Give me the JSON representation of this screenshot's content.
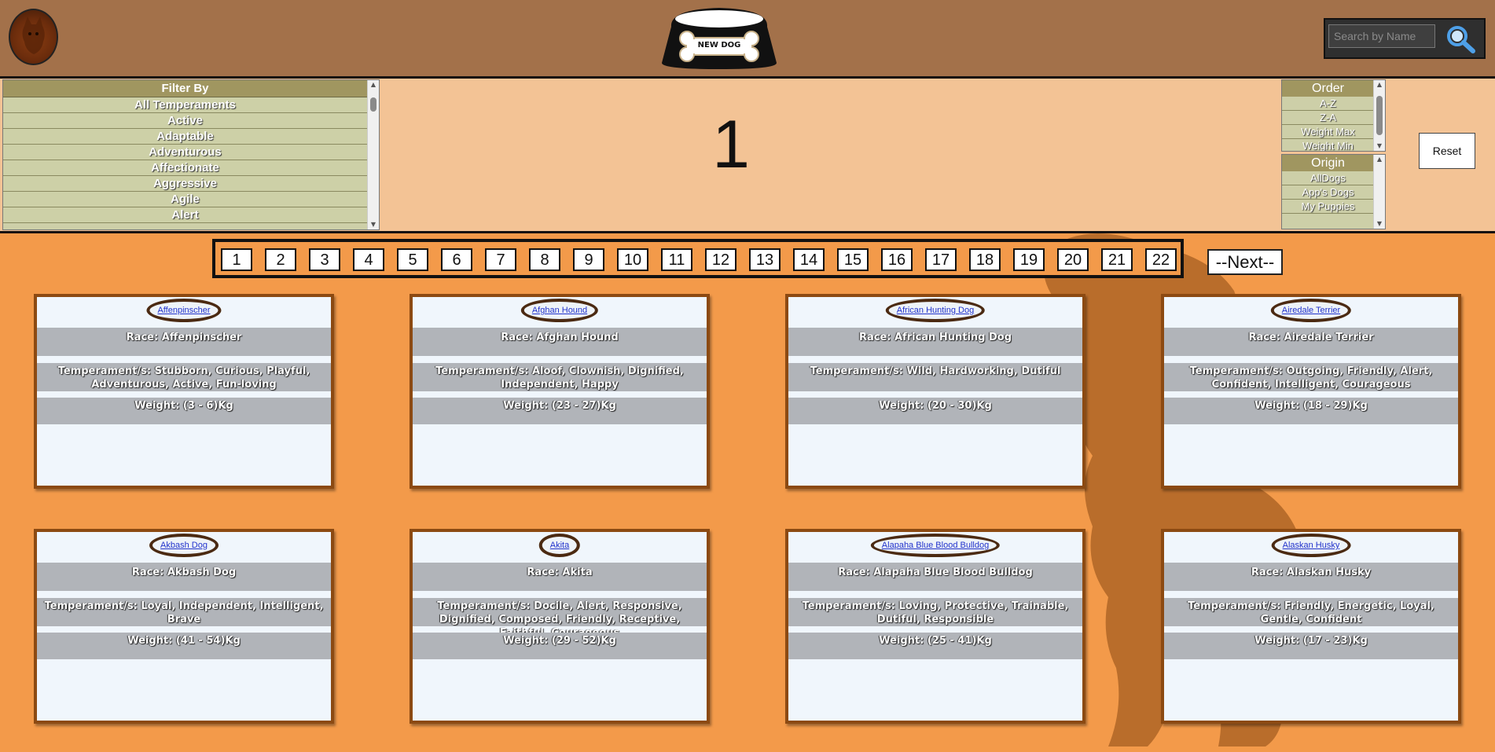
{
  "header": {
    "logo_icon": "dog-avatar-icon",
    "new_dog_label": "NEW DOG",
    "search": {
      "placeholder": "Search by Name",
      "icon": "search-icon"
    }
  },
  "filters": {
    "title": "Filter By",
    "temperaments": [
      "All Temperaments",
      "Active",
      "Adaptable",
      "Adventurous",
      "Affectionate",
      "Aggressive",
      "Agile",
      "Alert"
    ]
  },
  "current_page": "1",
  "order": {
    "title": "Order",
    "items": [
      "A-Z",
      "Z-A",
      "Weight Max",
      "Weight Min"
    ]
  },
  "origin": {
    "title": "Origin",
    "items": [
      "AllDogs",
      "App's Dogs",
      "My Puppies"
    ]
  },
  "reset_label": "Reset",
  "pagination": {
    "pages": [
      "1",
      "2",
      "3",
      "4",
      "5",
      "6",
      "7",
      "8",
      "9",
      "10",
      "11",
      "12",
      "13",
      "14",
      "15",
      "16",
      "17",
      "18",
      "19",
      "20",
      "21",
      "22"
    ],
    "next_label": "--Next--"
  },
  "cards": [
    {
      "img_alt": "Affenpinscher",
      "race": "Race: Affenpinscher",
      "temperament": "Temperament/s: Stubborn, Curious, Playful, Adventurous, Active, Fun-loving",
      "weight": "Weight: (3 - 6)Kg"
    },
    {
      "img_alt": "Afghan Hound",
      "race": "Race: Afghan Hound",
      "temperament": "Temperament/s: Aloof, Clownish, Dignified, Independent, Happy",
      "weight": "Weight: (23 - 27)Kg"
    },
    {
      "img_alt": "African Hunting Dog",
      "race": "Race: African Hunting Dog",
      "temperament": "Temperament/s: Wild, Hardworking, Dutiful",
      "weight": "Weight: (20 - 30)Kg"
    },
    {
      "img_alt": "Airedale Terrier",
      "race": "Race: Airedale Terrier",
      "temperament": "Temperament/s: Outgoing, Friendly, Alert, Confident, Intelligent, Courageous",
      "weight": "Weight: (18 - 29)Kg"
    },
    {
      "img_alt": "Akbash Dog",
      "race": "Race: Akbash Dog",
      "temperament": "Temperament/s: Loyal, Independent, Intelligent, Brave",
      "weight": "Weight: (41 - 54)Kg"
    },
    {
      "img_alt": "Akita",
      "race": "Race: Akita",
      "temperament": "Temperament/s: Docile, Alert, Responsive, Dignified, Composed, Friendly, Receptive, Faithful, Courageous",
      "weight": "Weight: (29 - 52)Kg"
    },
    {
      "img_alt": "Alapaha Blue Blood Bulldog",
      "race": "Race: Alapaha Blue Blood Bulldog",
      "temperament": "Temperament/s: Loving, Protective, Trainable, Dutiful, Responsible",
      "weight": "Weight: (25 - 41)Kg"
    },
    {
      "img_alt": "Alaskan Husky",
      "race": "Race: Alaskan Husky",
      "temperament": "Temperament/s: Friendly, Energetic, Loyal, Gentle, Confident",
      "weight": "Weight: (17 - 23)Kg"
    }
  ]
}
